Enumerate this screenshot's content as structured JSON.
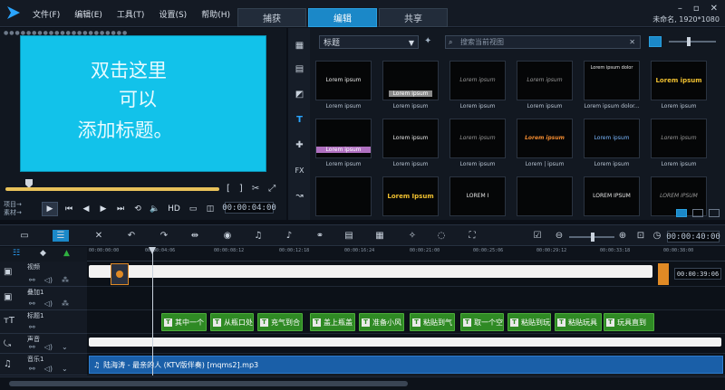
{
  "menu": {
    "items": [
      "文件(F)",
      "编辑(E)",
      "工具(T)",
      "设置(S)",
      "帮助(H)"
    ]
  },
  "tabs": [
    {
      "label": "捕获",
      "active": false
    },
    {
      "label": "编辑",
      "active": true
    },
    {
      "label": "共享",
      "active": false
    }
  ],
  "window": {
    "project_info": "未命名, 1920*1080",
    "minimize": "–",
    "restore": "▫",
    "close": "✕"
  },
  "player": {
    "preview_lines": [
      "双击这里",
      "可以",
      "添加标题。"
    ],
    "mode_project": "项目→",
    "mode_clip": "素材→",
    "hd": "HD",
    "timecode": "00:00:04:00",
    "trim_start": "[",
    "trim_end": "]"
  },
  "library": {
    "category": "标题",
    "search_placeholder": "搜索当前视图",
    "items": [
      {
        "thumb": "Lorem ipsum",
        "caption": "Lorem ipsum",
        "style": "plain"
      },
      {
        "thumb": "Lorem ipsum",
        "caption": "Lorem ipsum",
        "style": "bar-gray"
      },
      {
        "thumb": "Lorem ipsum",
        "caption": "Lorem ipsum",
        "style": "faint"
      },
      {
        "thumb": "Lorem ipsum",
        "caption": "Lorem ipsum",
        "style": "faint"
      },
      {
        "thumb": "Lorem ipsum dolor",
        "caption": "Lorem ipsum dolor...",
        "style": "small"
      },
      {
        "thumb": "Lorem ipsum",
        "caption": "Lorem ipsum",
        "style": "color"
      },
      {
        "thumb": "Lorem ipsum",
        "caption": "Lorem ipsum",
        "style": "bar-purple"
      },
      {
        "thumb": "Lorem ipsum",
        "caption": "Lorem ipsum",
        "style": "plain"
      },
      {
        "thumb": "Lorem ipsum",
        "caption": "Lorem ipsum",
        "style": "faint"
      },
      {
        "thumb": "Lorem ipsum",
        "caption": "Lorem | ipsum",
        "style": "orange"
      },
      {
        "thumb": "Lorem ipsum",
        "caption": "Lorem ipsum",
        "style": "blue"
      },
      {
        "thumb": "Lorem ipsum",
        "caption": "Lorem ipsum",
        "style": "faint"
      },
      {
        "thumb": "",
        "caption": "",
        "style": "small"
      },
      {
        "thumb": "Lorem Ipsum",
        "caption": "",
        "style": "color"
      },
      {
        "thumb": "LOREM I",
        "caption": "",
        "style": "plain"
      },
      {
        "thumb": "",
        "caption": "",
        "style": "blue"
      },
      {
        "thumb": "LOREM IPSUM",
        "caption": "",
        "style": "plain"
      },
      {
        "thumb": "LOREM IPSUM",
        "caption": "",
        "style": "faint"
      }
    ]
  },
  "timeline": {
    "timecode": "00:00:40:00",
    "ruler": [
      "00:00:00:00",
      "00:00:04:06",
      "00:00:08:12",
      "00:00:12:18",
      "00:00:16:24",
      "00:00:21:00",
      "00:00:25:06",
      "00:00:29:12",
      "00:00:33:18",
      "00:00:38:00"
    ],
    "tracks": [
      {
        "name": "视频",
        "icon": "video-track-icon"
      },
      {
        "name": "叠加1",
        "icon": "overlay-track-icon"
      },
      {
        "name": "标题1",
        "icon": "title-track-icon"
      },
      {
        "name": "声音",
        "icon": "voice-track-icon"
      },
      {
        "name": "音乐1",
        "icon": "music-track-icon"
      }
    ],
    "video_end_time": "00:00:39:06",
    "title_clips": [
      "其中一个",
      "从瓶口处",
      "充气到合",
      "盖上瓶盖",
      "准备小风",
      "粘贴到气",
      "取一个空",
      "粘贴到玩",
      "粘贴玩具",
      "玩具直到"
    ],
    "music_clip": "陆海涛 - 最亲的人 (KTV版伴奏) [mqms2].mp3"
  }
}
